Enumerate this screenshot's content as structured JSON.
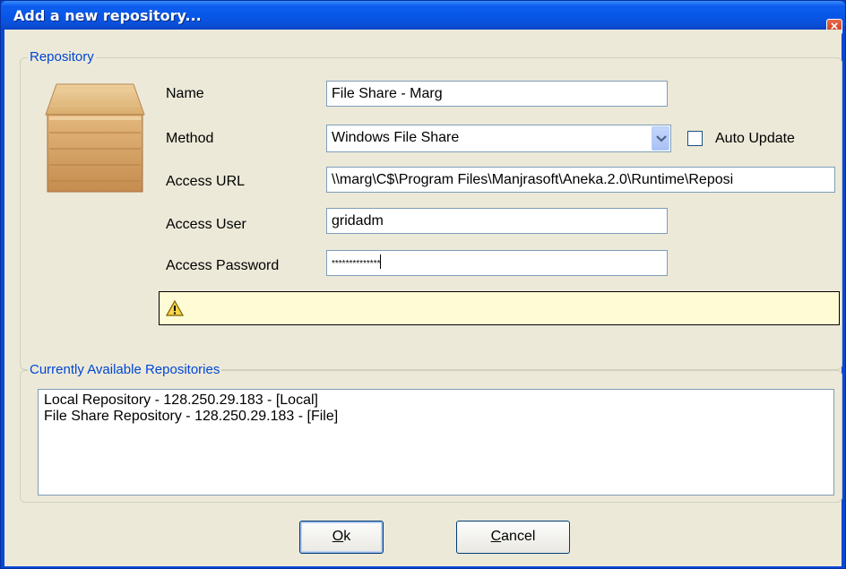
{
  "window": {
    "title": "Add a new repository...",
    "close_glyph": "×"
  },
  "repository_group": {
    "legend": "Repository",
    "icon": "box-icon",
    "fields": {
      "name_label": "Name",
      "name_value": "File Share - Marg",
      "method_label": "Method",
      "method_value": "Windows File Share",
      "auto_update_label": "Auto Update",
      "auto_update_checked": false,
      "access_url_label": "Access URL",
      "access_url_value": "\\\\marg\\C$\\Program Files\\Manjrasoft\\Aneka.2.0\\Runtime\\Reposi",
      "access_user_label": "Access User",
      "access_user_value": "gridadm",
      "access_password_label": "Access Password",
      "access_password_value": "**************"
    },
    "warning_icon": "warning-icon"
  },
  "available_group": {
    "legend": "Currently Available Repositories",
    "items": [
      "Local Repository - 128.250.29.183 - [Local]",
      "File Share Repository - 128.250.29.183 - [File]"
    ]
  },
  "buttons": {
    "ok_hot": "O",
    "ok_rest": "k",
    "cancel_hot": "C",
    "cancel_rest": "ancel"
  },
  "colors": {
    "title_bar": "#0a4fd8",
    "dialog_background": "#ece9d8",
    "group_legend": "#0046d5",
    "warning_background": "#fffbd5"
  }
}
